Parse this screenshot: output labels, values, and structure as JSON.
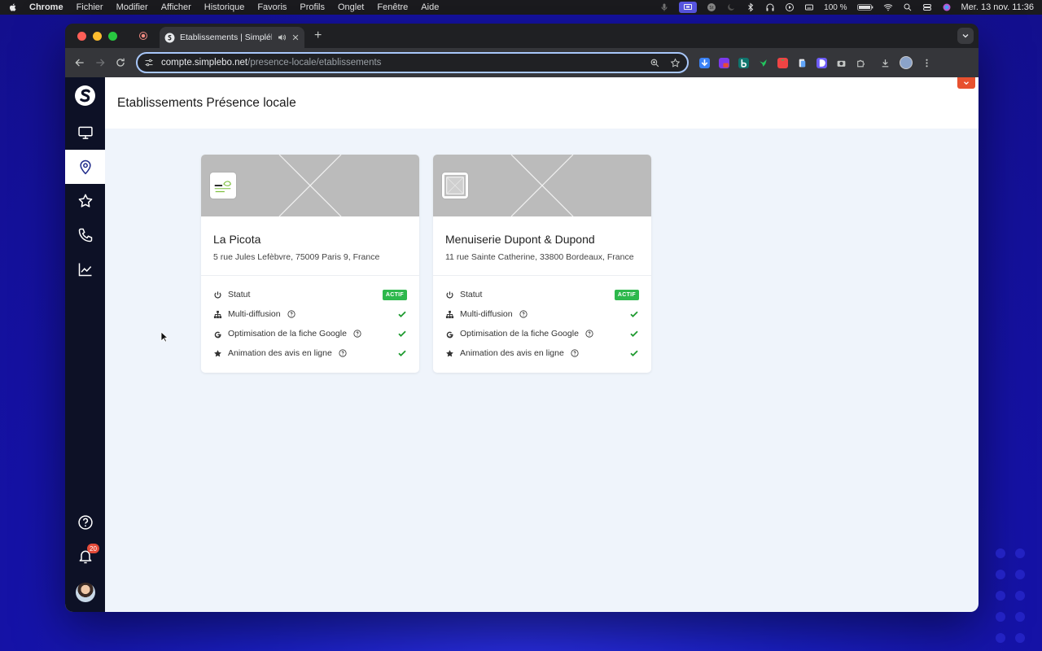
{
  "menubar": {
    "app_name": "Chrome",
    "menus": [
      "Fichier",
      "Modifier",
      "Afficher",
      "Historique",
      "Favoris",
      "Profils",
      "Onglet",
      "Fenêtre",
      "Aide"
    ],
    "battery": "100 %",
    "datetime": "Mer. 13 nov.  11:36"
  },
  "browser": {
    "tab_title": "Etablissements | Simplébo",
    "new_tab_label": "+",
    "url_host": "compte.simplebo.net",
    "url_path": "/presence-locale/etablissements"
  },
  "header": {
    "title": "Etablissements Présence locale"
  },
  "sidebar": {
    "notifications_count": "20"
  },
  "establishments": [
    {
      "name": "La Picota",
      "address": "5 rue Jules Lefèbvre, 75009 Paris 9, France",
      "status_label": "Statut",
      "status_value": "ACTIF",
      "features": [
        {
          "label": "Multi-diffusion",
          "icon": "sitemap-icon",
          "enabled": true
        },
        {
          "label": "Optimisation de la fiche Google",
          "icon": "google-icon",
          "enabled": true
        },
        {
          "label": "Animation des avis en ligne",
          "icon": "star-icon",
          "enabled": true
        }
      ]
    },
    {
      "name": "Menuiserie Dupont & Dupond",
      "address": "11 rue Sainte Catherine, 33800 Bordeaux, France",
      "status_label": "Statut",
      "status_value": "ACTIF",
      "features": [
        {
          "label": "Multi-diffusion",
          "icon": "sitemap-icon",
          "enabled": true
        },
        {
          "label": "Optimisation de la fiche Google",
          "icon": "google-icon",
          "enabled": true
        },
        {
          "label": "Animation des avis en ligne",
          "icon": "star-icon",
          "enabled": true
        }
      ]
    }
  ],
  "colors": {
    "sidebar_bg": "#0d1126",
    "content_bg": "#eff4fb",
    "badge_green": "#2db84c",
    "check_green": "#1e9a2f",
    "accent_orange": "#e8512f",
    "notif_red": "#e44b3a"
  }
}
